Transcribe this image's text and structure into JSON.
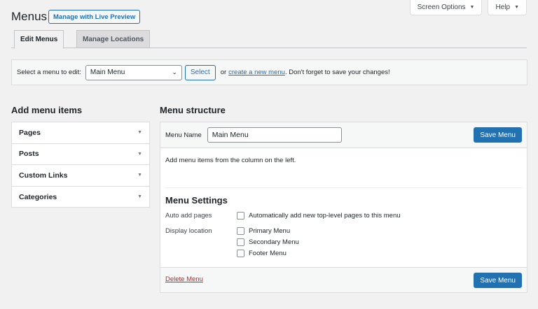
{
  "header": {
    "title": "Menus",
    "live_preview_label": "Manage with Live Preview"
  },
  "screen_meta": {
    "screen_options_label": "Screen Options",
    "help_label": "Help",
    "arrow_glyph": "▼"
  },
  "tabs": [
    {
      "label": "Edit Menus",
      "active": true
    },
    {
      "label": "Manage Locations",
      "active": false
    }
  ],
  "select_bar": {
    "prompt": "Select a menu to edit:",
    "selected_value": "Main Menu",
    "select_button_label": "Select",
    "or_text": "or",
    "create_link": "create a new menu",
    "after_link": ". Don't forget to save your changes!"
  },
  "add_items": {
    "heading": "Add menu items",
    "items": [
      {
        "label": "Pages"
      },
      {
        "label": "Posts"
      },
      {
        "label": "Custom Links"
      },
      {
        "label": "Categories"
      }
    ]
  },
  "structure": {
    "heading": "Menu structure",
    "menu_name_label": "Menu Name",
    "menu_name_value": "Main Menu",
    "save_label": "Save Menu",
    "hint": "Add menu items from the column on the left.",
    "settings_title": "Menu Settings",
    "auto_add_label": "Auto add pages",
    "auto_add_option": "Automatically add new top-level pages to this menu",
    "display_location_label": "Display location",
    "locations": [
      {
        "label": "Primary Menu"
      },
      {
        "label": "Secondary Menu"
      },
      {
        "label": "Footer Menu"
      }
    ],
    "delete_label": "Delete Menu"
  },
  "colors": {
    "accent": "#2271b1",
    "danger": "#b32d2e",
    "background": "#f1f1f1"
  }
}
